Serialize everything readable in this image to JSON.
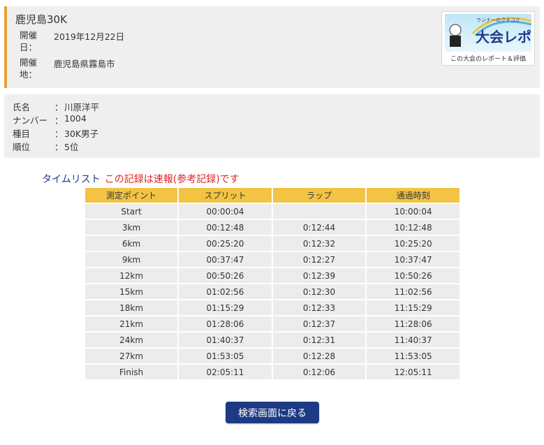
{
  "race": {
    "title": "鹿児島30K",
    "date_label": "開催日：",
    "date_value": "2019年12月22日",
    "place_label": "開催地：",
    "place_value": "鹿児島県霧島市"
  },
  "banner": {
    "art_text": "ランナーのクチコミ 大会レポ",
    "caption": "この大会のレポート＆評価"
  },
  "runner": {
    "rows": [
      {
        "key": "氏名",
        "sep": "：",
        "value": "川原洋平"
      },
      {
        "key": "ナンバー",
        "sep": "：",
        "value": "1004"
      },
      {
        "key": "種目",
        "sep": "：",
        "value": "30K男子"
      },
      {
        "key": "順位",
        "sep": "：",
        "value": "5位"
      }
    ]
  },
  "timelist": {
    "heading": "タイムリスト",
    "notice": "この記録は速報(参考記録)です",
    "columns": [
      "測定ポイント",
      "スプリット",
      "ラップ",
      "通過時刻"
    ],
    "rows": [
      [
        "Start",
        "00:00:04",
        "",
        "10:00:04"
      ],
      [
        "3km",
        "00:12:48",
        "0:12:44",
        "10:12:48"
      ],
      [
        "6km",
        "00:25:20",
        "0:12:32",
        "10:25:20"
      ],
      [
        "9km",
        "00:37:47",
        "0:12:27",
        "10:37:47"
      ],
      [
        "12km",
        "00:50:26",
        "0:12:39",
        "10:50:26"
      ],
      [
        "15km",
        "01:02:56",
        "0:12:30",
        "11:02:56"
      ],
      [
        "18km",
        "01:15:29",
        "0:12:33",
        "11:15:29"
      ],
      [
        "21km",
        "01:28:06",
        "0:12:37",
        "11:28:06"
      ],
      [
        "24km",
        "01:40:37",
        "0:12:31",
        "11:40:37"
      ],
      [
        "27km",
        "01:53:05",
        "0:12:28",
        "11:53:05"
      ],
      [
        "Finish",
        "02:05:11",
        "0:12:06",
        "12:05:11"
      ]
    ]
  },
  "back_button": {
    "label": "検索画面に戻る"
  },
  "colors": {
    "accent_bar": "#e8a23a",
    "table_header": "#f3c343",
    "heading_blue": "#1f3b8c",
    "notice_red": "#e02424",
    "button_navy": "#1e3a85"
  }
}
